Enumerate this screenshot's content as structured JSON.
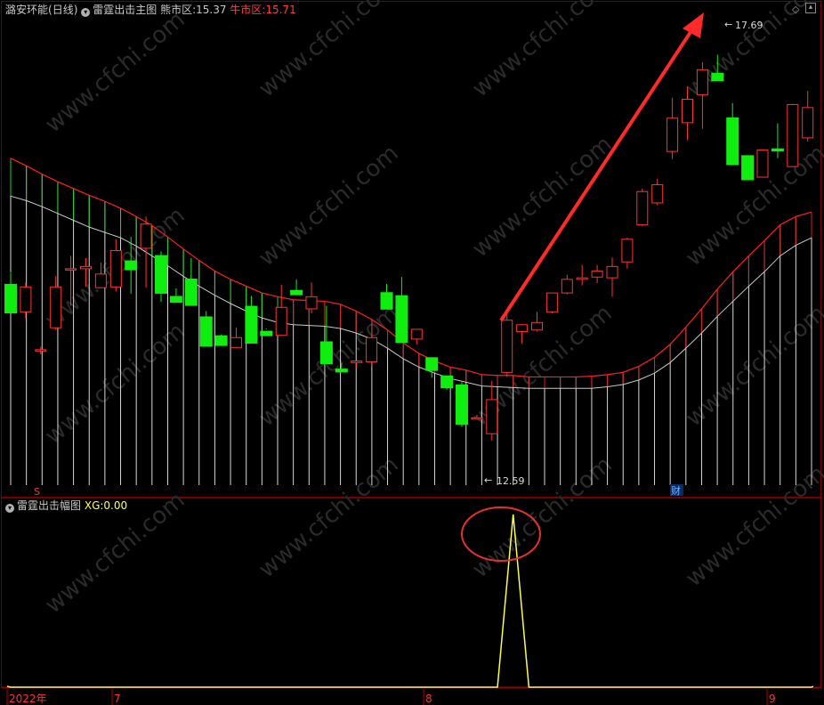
{
  "header": {
    "stock_name": "潞安环能",
    "period": "(日线)",
    "indicator_title": "雷霆出击主图",
    "bear_label": "熊市区:",
    "bear_value": "15.37",
    "bull_label": "牛市区:",
    "bull_value": "15.71"
  },
  "subpanel": {
    "indicator_title": "雷霆出击幅图",
    "xg_label": "XG:",
    "xg_value": "0.00"
  },
  "markers": {
    "high_label": "17.69",
    "low_label": "12.59",
    "s_marker": "S",
    "cai_marker": "财"
  },
  "watermark": "www.cfchi.com",
  "colors": {
    "background": "#000000",
    "up_candle": "#ff3232",
    "down_candle": "#10ee10",
    "upper_band": "#ff2020",
    "lower_band": "#c8c8c8",
    "xg_line": "#ffff40",
    "arrow": "#ff2a2a",
    "grid": "#8a1010"
  },
  "chart_data": {
    "type": "candlestick",
    "x_labels": [
      "2022年",
      "7",
      "8",
      "9"
    ],
    "price_range": [
      12.1,
      18.3
    ],
    "candles": [
      {
        "o": 14.76,
        "h": 14.92,
        "l": 14.59,
        "c": 14.37
      },
      {
        "o": 14.39,
        "h": 14.78,
        "l": 14.31,
        "c": 14.72
      },
      {
        "o": 13.89,
        "h": 13.93,
        "l": 13.83,
        "c": 13.89
      },
      {
        "o": 14.18,
        "h": 14.86,
        "l": 14.15,
        "c": 14.72
      },
      {
        "o": 14.96,
        "h": 15.13,
        "l": 14.47,
        "c": 14.96
      },
      {
        "o": 14.96,
        "h": 15.1,
        "l": 14.72,
        "c": 14.99
      },
      {
        "o": 14.71,
        "h": 15.04,
        "l": 14.74,
        "c": 14.89
      },
      {
        "o": 14.72,
        "h": 15.35,
        "l": 14.66,
        "c": 15.2
      },
      {
        "o": 15.07,
        "h": 15.38,
        "l": 14.63,
        "c": 14.94
      },
      {
        "o": 15.23,
        "h": 15.65,
        "l": 14.71,
        "c": 15.55
      },
      {
        "o": 15.14,
        "h": 15.19,
        "l": 14.52,
        "c": 14.63
      },
      {
        "o": 14.6,
        "h": 14.7,
        "l": 14.58,
        "c": 14.51
      },
      {
        "o": 14.83,
        "h": 15.1,
        "l": 14.73,
        "c": 14.47
      },
      {
        "o": 14.33,
        "h": 14.4,
        "l": 13.94,
        "c": 13.93
      },
      {
        "o": 14.08,
        "h": 14.09,
        "l": 13.94,
        "c": 13.94
      },
      {
        "o": 13.92,
        "h": 14.18,
        "l": 13.95,
        "c": 14.05
      },
      {
        "o": 14.47,
        "h": 14.6,
        "l": 14.32,
        "c": 13.97
      },
      {
        "o": 14.14,
        "h": 14.17,
        "l": 14.16,
        "c": 14.07
      },
      {
        "o": 14.08,
        "h": 14.75,
        "l": 14.07,
        "c": 14.45
      },
      {
        "o": 14.68,
        "h": 14.82,
        "l": 14.67,
        "c": 14.61
      },
      {
        "o": 14.43,
        "h": 14.78,
        "l": 14.37,
        "c": 14.59
      },
      {
        "o": 14.0,
        "h": 14.47,
        "l": 13.84,
        "c": 13.7
      },
      {
        "o": 13.64,
        "h": 13.71,
        "l": 13.59,
        "c": 13.59
      },
      {
        "o": 13.72,
        "h": 13.73,
        "l": 13.65,
        "c": 13.74
      },
      {
        "o": 13.73,
        "h": 14.08,
        "l": 13.67,
        "c": 14.05
      },
      {
        "o": 14.65,
        "h": 14.76,
        "l": 14.49,
        "c": 14.42
      },
      {
        "o": 14.61,
        "h": 14.85,
        "l": 14.05,
        "c": 13.98
      },
      {
        "o": 14.03,
        "h": 14.13,
        "l": 13.96,
        "c": 14.16
      },
      {
        "o": 13.79,
        "h": 13.79,
        "l": 13.52,
        "c": 13.61
      },
      {
        "o": 13.55,
        "h": 13.53,
        "l": 13.36,
        "c": 13.38
      },
      {
        "o": 13.43,
        "h": 13.46,
        "l": 12.87,
        "c": 12.9
      },
      {
        "o": 12.99,
        "h": 13.03,
        "l": 12.98,
        "c": 12.99
      },
      {
        "o": 12.78,
        "h": 13.48,
        "l": 12.69,
        "c": 13.23
      },
      {
        "o": 13.59,
        "h": 14.37,
        "l": 13.53,
        "c": 14.28
      },
      {
        "o": 14.13,
        "h": 14.23,
        "l": 13.97,
        "c": 14.22
      },
      {
        "o": 14.15,
        "h": 14.39,
        "l": 14.13,
        "c": 14.25
      },
      {
        "o": 14.39,
        "h": 14.64,
        "l": 14.37,
        "c": 14.64
      },
      {
        "o": 14.64,
        "h": 14.88,
        "l": 14.62,
        "c": 14.82
      },
      {
        "o": 14.82,
        "h": 15.01,
        "l": 14.74,
        "c": 14.84
      },
      {
        "o": 14.85,
        "h": 15.01,
        "l": 14.77,
        "c": 14.93
      },
      {
        "o": 14.84,
        "h": 15.11,
        "l": 14.59,
        "c": 14.99
      },
      {
        "o": 15.05,
        "h": 15.37,
        "l": 14.96,
        "c": 15.35
      },
      {
        "o": 15.54,
        "h": 16.02,
        "l": 15.52,
        "c": 15.98
      },
      {
        "o": 15.83,
        "h": 16.15,
        "l": 15.8,
        "c": 16.07
      },
      {
        "o": 16.51,
        "h": 17.22,
        "l": 16.41,
        "c": 16.95
      },
      {
        "o": 16.89,
        "h": 17.37,
        "l": 16.66,
        "c": 17.2
      },
      {
        "o": 17.26,
        "h": 17.69,
        "l": 16.81,
        "c": 17.59
      },
      {
        "o": 17.55,
        "h": 17.79,
        "l": 17.48,
        "c": 17.44
      },
      {
        "o": 16.96,
        "h": 17.15,
        "l": 16.65,
        "c": 16.33
      },
      {
        "o": 16.46,
        "h": 16.41,
        "l": 16.44,
        "c": 16.13
      },
      {
        "o": 16.17,
        "h": 16.47,
        "l": 16.4,
        "c": 16.53
      },
      {
        "o": 16.55,
        "h": 16.88,
        "l": 16.42,
        "c": 16.51
      },
      {
        "o": 16.31,
        "h": 17.14,
        "l": 16.36,
        "c": 17.13
      },
      {
        "o": 16.69,
        "h": 17.31,
        "l": 16.64,
        "c": 17.09
      }
    ],
    "upper_band": [
      16.42,
      16.32,
      16.21,
      16.11,
      16.02,
      15.93,
      15.85,
      15.76,
      15.65,
      15.53,
      15.38,
      15.22,
      15.07,
      14.93,
      14.82,
      14.73,
      14.64,
      14.59,
      14.55,
      14.54,
      14.53,
      14.49,
      14.4,
      14.29,
      14.15,
      13.98,
      13.84,
      13.74,
      13.66,
      13.62,
      13.56,
      13.55,
      13.55,
      13.53,
      13.53,
      13.53,
      13.53,
      13.54,
      13.56,
      13.59,
      13.67,
      13.79,
      13.96,
      14.19,
      14.43,
      14.69,
      14.92,
      15.13,
      15.33,
      15.54,
      15.65,
      15.71
    ],
    "lower_band": [
      15.92,
      15.86,
      15.78,
      15.69,
      15.6,
      15.51,
      15.44,
      15.37,
      15.26,
      15.13,
      15.0,
      14.86,
      14.73,
      14.61,
      14.5,
      14.4,
      14.31,
      14.25,
      14.22,
      14.21,
      14.2,
      14.17,
      14.11,
      14.03,
      13.91,
      13.77,
      13.66,
      13.58,
      13.51,
      13.46,
      13.41,
      13.4,
      13.39,
      13.38,
      13.38,
      13.38,
      13.38,
      13.38,
      13.4,
      13.43,
      13.49,
      13.58,
      13.72,
      13.91,
      14.11,
      14.33,
      14.53,
      14.73,
      14.92,
      15.13,
      15.27,
      15.37
    ],
    "high_annotation": {
      "label": "17.69",
      "value": 17.69
    },
    "low_annotation": {
      "label": "12.59",
      "value": 12.59
    },
    "sub_series": {
      "name": "XG",
      "values": [
        0,
        0,
        0,
        0,
        0,
        0,
        0,
        0,
        0,
        0,
        0,
        0,
        0,
        0,
        0,
        0,
        0,
        0,
        0,
        0,
        0,
        0,
        0,
        0,
        0,
        0,
        0,
        0,
        0,
        0,
        0,
        0,
        1,
        0,
        0,
        0,
        0,
        0,
        0,
        0,
        0,
        0,
        0,
        0,
        0,
        0,
        0,
        0,
        0,
        0,
        0,
        0
      ]
    }
  }
}
